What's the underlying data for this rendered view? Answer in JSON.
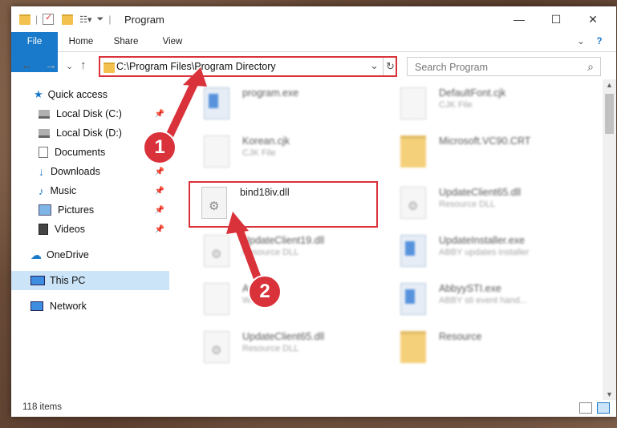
{
  "window": {
    "title": "Program",
    "controls": {
      "minimize": "—",
      "maximize": "☐",
      "close": "✕"
    }
  },
  "ribbon": {
    "tabs": [
      {
        "label": "File"
      },
      {
        "label": "Home"
      },
      {
        "label": "Share"
      },
      {
        "label": "View"
      }
    ],
    "expand": "⌄",
    "help": "?"
  },
  "navigation": {
    "back": "←",
    "forward": "→",
    "recent": "⌄",
    "up": "↑",
    "address": "C:\\Program Files\\Program Directory",
    "dropdown": "⌄",
    "refresh": "↻",
    "search_placeholder": "Search Program",
    "search_icon": "⌕"
  },
  "sidebar": {
    "items": [
      {
        "label": "Quick access",
        "icon": "star-icon",
        "pinned": false
      },
      {
        "label": "Local Disk (C:)",
        "icon": "drive-icon",
        "pinned": true
      },
      {
        "label": "Local Disk (D:)",
        "icon": "drive-icon",
        "pinned": false
      },
      {
        "label": "Documents",
        "icon": "documents-icon",
        "pinned": false
      },
      {
        "label": "Downloads",
        "icon": "download-icon",
        "pinned": true
      },
      {
        "label": "Music",
        "icon": "music-icon",
        "pinned": true
      },
      {
        "label": "Pictures",
        "icon": "pictures-icon",
        "pinned": true
      },
      {
        "label": "Videos",
        "icon": "videos-icon",
        "pinned": true
      },
      {
        "label": "OneDrive",
        "icon": "cloud-icon",
        "pinned": false
      },
      {
        "label": "This PC",
        "icon": "pc-icon",
        "pinned": false,
        "selected": true
      },
      {
        "label": "Network",
        "icon": "network-icon",
        "pinned": false
      }
    ],
    "pin_glyph": "📌"
  },
  "files": [
    {
      "name": "program.exe",
      "type": "",
      "icon": "app-icon"
    },
    {
      "name": "DefaultFont.cjk",
      "type": "CJK File",
      "icon": "file-icon"
    },
    {
      "name": "Korean.cjk",
      "type": "CJK File",
      "icon": "file-icon"
    },
    {
      "name": "Microsoft.VC90.CRT",
      "type": "",
      "icon": "folder-icon"
    },
    {
      "name": "bind18iv.dll",
      "type": "",
      "icon": "dll-icon",
      "highlighted": true
    },
    {
      "name": "UpdateClient65.dll",
      "type": "Resource DLL",
      "icon": "dll-icon"
    },
    {
      "name": "UpdateClient19.dll",
      "type": "Resource DLL",
      "icon": "dll-icon"
    },
    {
      "name": "UpdateInstaller.exe",
      "type": "ABBY updates installer",
      "icon": "app-icon"
    },
    {
      "name": "Arab...",
      "type": "WRD...",
      "icon": "file-icon"
    },
    {
      "name": "AbbyySTI.exe",
      "type": "ABBY sti event hand...",
      "icon": "app-icon"
    },
    {
      "name": "UpdateClient65.dll",
      "type": "Resource DLL",
      "icon": "dll-icon"
    },
    {
      "name": "Resource",
      "type": "",
      "icon": "folder-icon"
    }
  ],
  "annotations": {
    "step1": "1",
    "step2": "2"
  },
  "status": {
    "items_count": "118 items"
  },
  "colors": {
    "accent": "#1979ca",
    "highlight": "#d9323a",
    "selected": "#cce4f7"
  }
}
